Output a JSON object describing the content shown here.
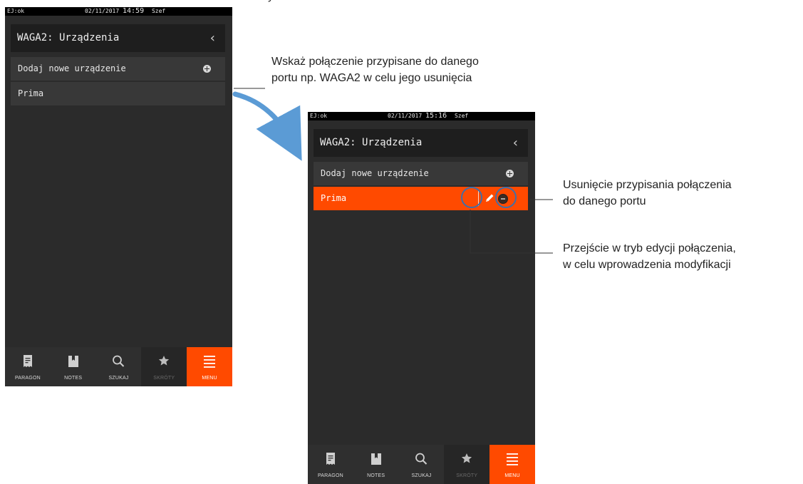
{
  "annotations": {
    "select_connection": "Wskaż połączenie przypisane do danego\nportu np. WAGA2 w celu jego usunięcia",
    "remove_assignment": "Usunięcie przypisania połączenia\ndo danego portu",
    "edit_connection": "Przejście w tryb edycji połączenia,\nw celu wprowadzenia modyfikacji"
  },
  "screen_before": {
    "status": {
      "ej": "EJ:ok",
      "date": "02/11/2017",
      "time": "14:59",
      "user": "Szef"
    },
    "header": {
      "title": "WAGA2: Urządzenia",
      "back_icon": "chevron-left-icon"
    },
    "rows": [
      {
        "label": "Dodaj nowe urządzenie",
        "icon": "plus-circle-icon"
      },
      {
        "label": "Prima"
      }
    ]
  },
  "screen_after": {
    "status": {
      "ej": "EJ:ok",
      "date": "02/11/2017",
      "time": "15:16",
      "user": "Szef"
    },
    "header": {
      "title": "WAGA2: Urządzenia",
      "back_icon": "chevron-left-icon"
    },
    "rows": [
      {
        "label": "Dodaj nowe urządzenie",
        "icon": "plus-circle-icon"
      },
      {
        "label": "Prima",
        "selected": true,
        "actions": [
          "pencil-icon",
          "minus-circle-icon"
        ]
      }
    ]
  },
  "bottom_nav": [
    {
      "label": "PARAGON",
      "icon": "receipt-icon"
    },
    {
      "label": "NOTES",
      "icon": "notes-icon"
    },
    {
      "label": "SZUKAJ",
      "icon": "search-icon"
    },
    {
      "label": "SKRÓTY",
      "icon": "star-icon",
      "state": "disabled"
    },
    {
      "label": "MENU",
      "icon": "menu-icon",
      "state": "active"
    }
  ],
  "colors": {
    "accent": "#ff4a00",
    "screen_bg": "#2b2b2b",
    "header_bg": "#1e1e1e",
    "row_bg": "#383838",
    "annotation_ring": "#3f6fa9",
    "arrow": "#5b9bd5"
  }
}
